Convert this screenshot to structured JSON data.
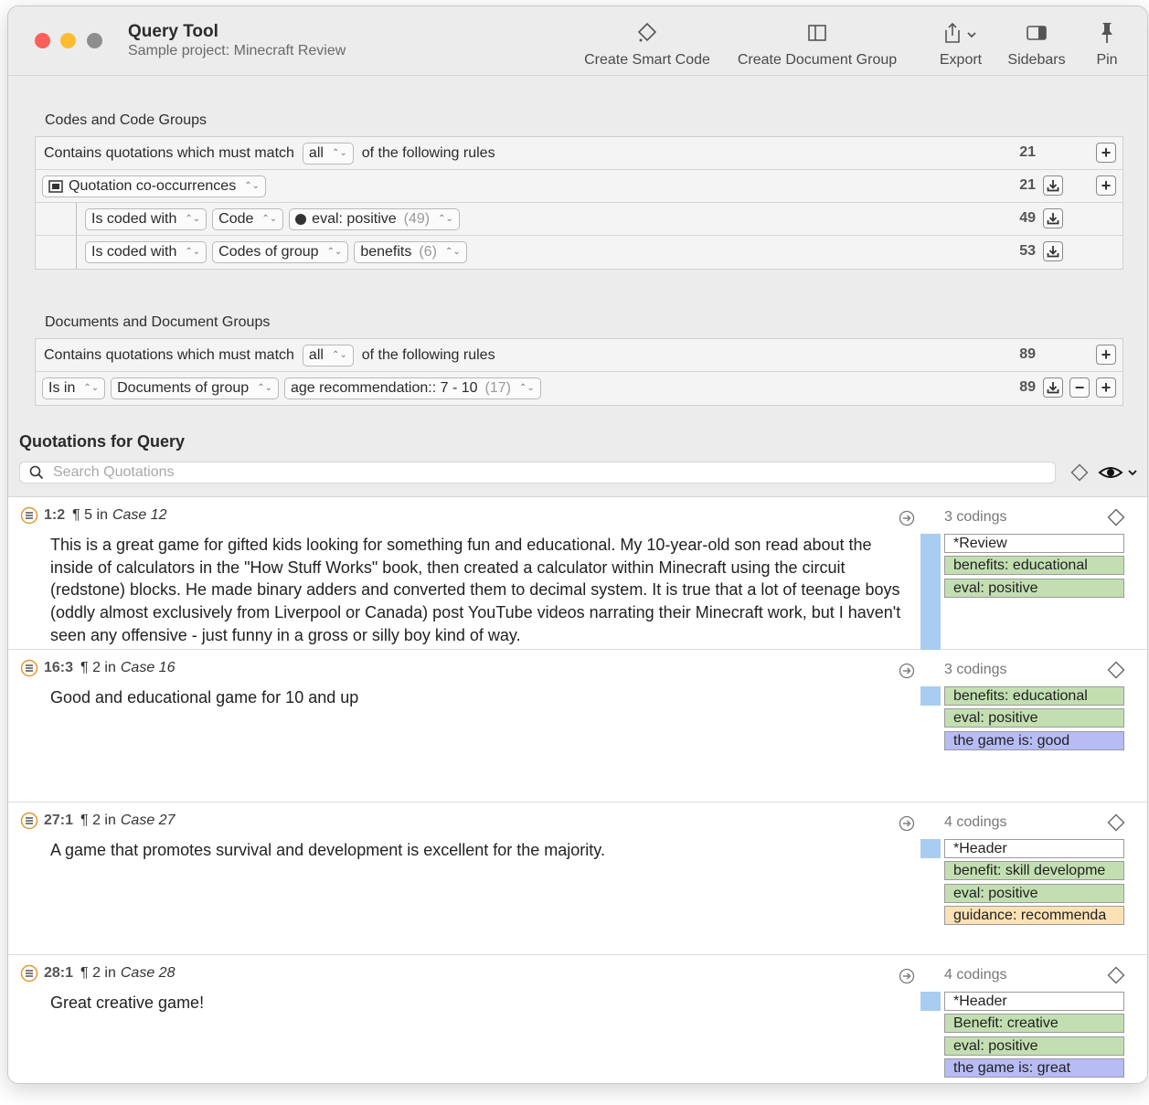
{
  "window": {
    "title": "Query Tool",
    "subtitle": "Sample project: Minecraft Review"
  },
  "toolbar": {
    "create_smart_code": "Create Smart Code",
    "create_document_group": "Create Document Group",
    "export": "Export",
    "sidebars": "Sidebars",
    "pin": "Pin"
  },
  "codes_section": {
    "title": "Codes and Code Groups",
    "header_row": {
      "prefix": "Contains quotations which must match",
      "match": "all",
      "suffix": "of the following rules",
      "count": "21"
    },
    "operator_row": {
      "label": "Quotation co-occurrences",
      "count": "21"
    },
    "rules": [
      {
        "condition": "Is coded with",
        "type": "Code",
        "value": "eval: positive",
        "value_count": "(49)",
        "count": "49"
      },
      {
        "condition": "Is coded with",
        "type": "Codes of group",
        "value": "benefits",
        "value_count": "(6)",
        "count": "53"
      }
    ]
  },
  "documents_section": {
    "title": "Documents and Document Groups",
    "header_row": {
      "prefix": "Contains quotations which must match",
      "match": "all",
      "suffix": "of the following rules",
      "count": "89"
    },
    "rule": {
      "condition": "Is in",
      "type": "Documents of group",
      "value": "age recommendation:: 7 - 10",
      "value_count": "(17)",
      "count": "89"
    }
  },
  "quotations": {
    "heading": "Quotations for Query",
    "search_placeholder": "Search Quotations",
    "items": [
      {
        "id": "1:2",
        "para": "¶ 5 in",
        "case": "Case 12",
        "codings": "3 codings",
        "text": "This is a great game for gifted kids looking for something fun and educational. My 10-year-old son read about the inside of calculators in the \"How Stuff Works\" book, then created a calculator within Minecraft using the circuit (redstone) blocks. He made binary adders and converted them to decimal system. It is true that a lot of teenage boys (oddly almost exclusively from Liverpool or Canada) post YouTube videos narrating their Minecraft work, but I haven't seen any offensive - just funny in a gross or silly boy kind of way.",
        "codes": [
          {
            "label": "*Review",
            "color": "#ffffff"
          },
          {
            "label": "benefits: educational",
            "color": "#c3dfb2"
          },
          {
            "label": "eval: positive",
            "color": "#c3dfb2"
          }
        ]
      },
      {
        "id": "16:3",
        "para": "¶ 2 in",
        "case": "Case 16",
        "codings": "3 codings",
        "text": "Good and educational game for 10 and up",
        "codes": [
          {
            "label": "benefits: educational",
            "color": "#c3dfb2"
          },
          {
            "label": "eval: positive",
            "color": "#c3dfb2"
          },
          {
            "label": "the game is: good",
            "color": "#b7bcf5"
          }
        ]
      },
      {
        "id": "27:1",
        "para": "¶ 2 in",
        "case": "Case 27",
        "codings": "4 codings",
        "text": "A game that promotes survival and development is excellent for the majority.",
        "codes": [
          {
            "label": "*Header",
            "color": "#ffffff"
          },
          {
            "label": "benefit: skill developme",
            "color": "#c3dfb2"
          },
          {
            "label": "eval: positive",
            "color": "#c3dfb2"
          },
          {
            "label": "guidance: recommenda",
            "color": "#fbe1b5"
          }
        ]
      },
      {
        "id": "28:1",
        "para": "¶ 2 in",
        "case": "Case 28",
        "codings": "4 codings",
        "text": "Great creative game!",
        "codes": [
          {
            "label": "*Header",
            "color": "#ffffff"
          },
          {
            "label": "Benefit: creative",
            "color": "#c3dfb2"
          },
          {
            "label": "eval: positive",
            "color": "#c3dfb2"
          },
          {
            "label": "the game is: great",
            "color": "#b7bcf5"
          }
        ]
      }
    ]
  }
}
